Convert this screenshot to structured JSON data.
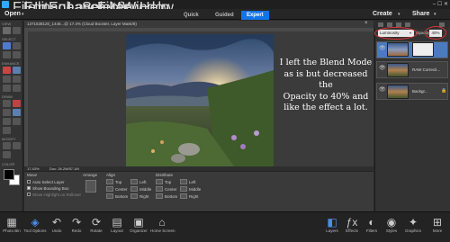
{
  "menubar": {
    "items": [
      "File",
      "Edit",
      "Image",
      "Enhance",
      "Layer",
      "Select",
      "Filter",
      "View",
      "Window",
      "Help"
    ],
    "window_controls": "– ☐ ✕"
  },
  "modebar": {
    "open": "Open",
    "modes": [
      "Quick",
      "Guided",
      "Expert"
    ],
    "create": "Create",
    "share": "Share"
  },
  "tools": {
    "sections": [
      "VIEW",
      "SELECT",
      "ENHANCE",
      "DRAW",
      "MODIFY",
      "COLOR"
    ]
  },
  "document": {
    "tab_title": "1371638120_1446...@ 17.4% (Cloud Booster, Layer Mask/8)",
    "overlay_text": [
      "I left the Blend Mode",
      "as is but decreased the",
      "Opacity to 40% and",
      "like the effect a lot."
    ],
    "zoom": "17.43%",
    "doc_size": "Doc: 26.2M/57.1M"
  },
  "options": {
    "move_label": "Move",
    "auto_select": "Auto Select Layer",
    "show_bbox": "Show Bounding Box",
    "show_highlight": "Show Highlight on Rollover",
    "arrange": "Arrange",
    "align": "Align",
    "distribute": "Distribute",
    "align_rows": [
      [
        "Top",
        "Left"
      ],
      [
        "Center",
        "Middle"
      ],
      [
        "Bottom",
        "Right"
      ]
    ],
    "distribute_rows": [
      [
        "Top",
        "Left"
      ],
      [
        "Center",
        "Middle"
      ],
      [
        "Bottom",
        "Right"
      ]
    ]
  },
  "layers_panel": {
    "blend_mode": "Luminosity",
    "opacity_label": "Opacity:",
    "opacity_value": "40%",
    "layers": [
      {
        "name": ""
      },
      {
        "name": "RAW Correcti..."
      },
      {
        "name": "Backgr..."
      }
    ]
  },
  "bottom_bar": {
    "left": [
      "Photo Bin",
      "Tool Options",
      "Undo",
      "Redo",
      "Rotate",
      "Layout",
      "Organizer",
      "Home Screen"
    ],
    "right": [
      "Layers",
      "Effects",
      "Filters",
      "Styles",
      "Graphics",
      "More"
    ]
  },
  "colors": {
    "accent": "#1473e6",
    "annotation": "#dd3333"
  }
}
